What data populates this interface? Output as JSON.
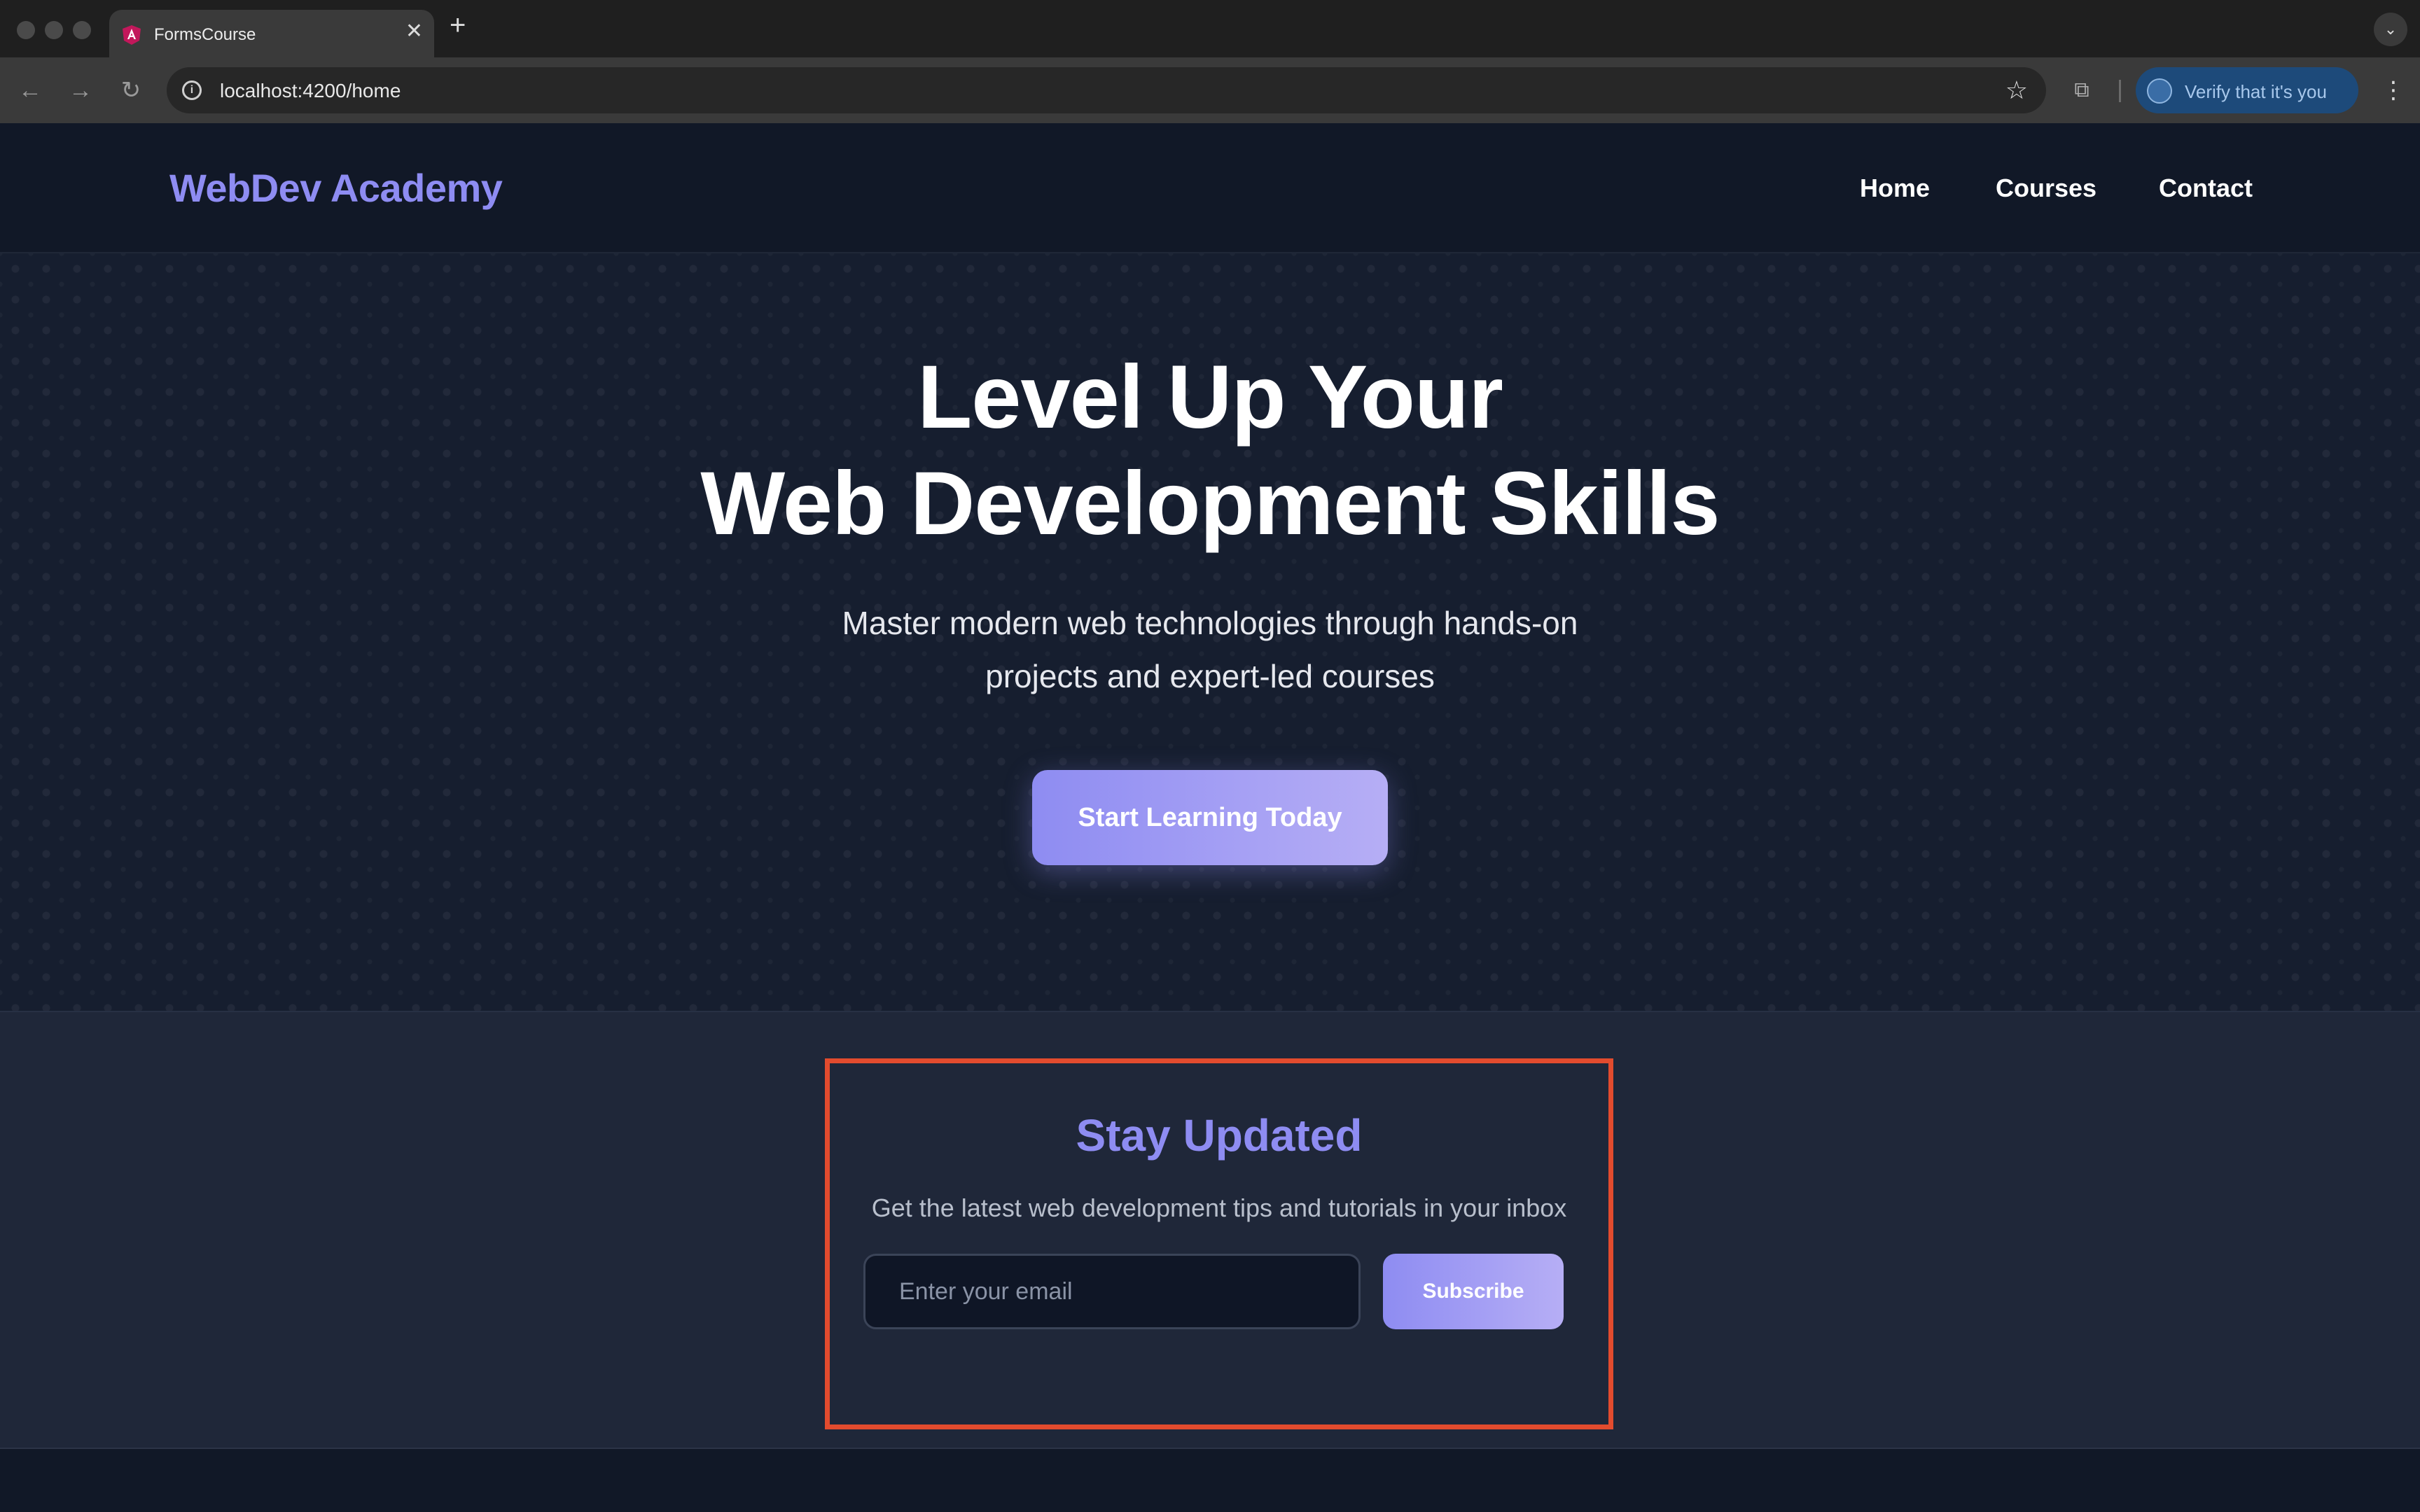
{
  "browser": {
    "tab_title": "FormsCourse",
    "new_tab_symbol": "+",
    "close_symbol": "✕",
    "url": "localhost:4200/home",
    "verify_label": "Verify that it's you",
    "icons": [
      "back-icon",
      "forward-icon",
      "reload-icon",
      "info-icon",
      "star-icon",
      "extensions-icon",
      "menu-icon"
    ]
  },
  "header": {
    "logo": "WebDev Academy",
    "nav": [
      {
        "label": "Home"
      },
      {
        "label": "Courses"
      },
      {
        "label": "Contact"
      }
    ]
  },
  "hero": {
    "title_line1": "Level Up Your",
    "title_line2": "Web Development Skills",
    "subtitle_line1": "Master modern web technologies through hands-on",
    "subtitle_line2": "projects and expert-led courses",
    "cta_label": "Start Learning Today"
  },
  "newsletter": {
    "title": "Stay Updated",
    "subtitle": "Get the latest web development tips and tutorials in your inbox",
    "email_value": "",
    "email_placeholder": "Enter your email",
    "subscribe_label": "Subscribe"
  },
  "colors": {
    "accent": "#8e8cf2",
    "accent_light": "#b6aef5",
    "page_bg": "#111827",
    "highlight_border": "#e24b2e"
  }
}
